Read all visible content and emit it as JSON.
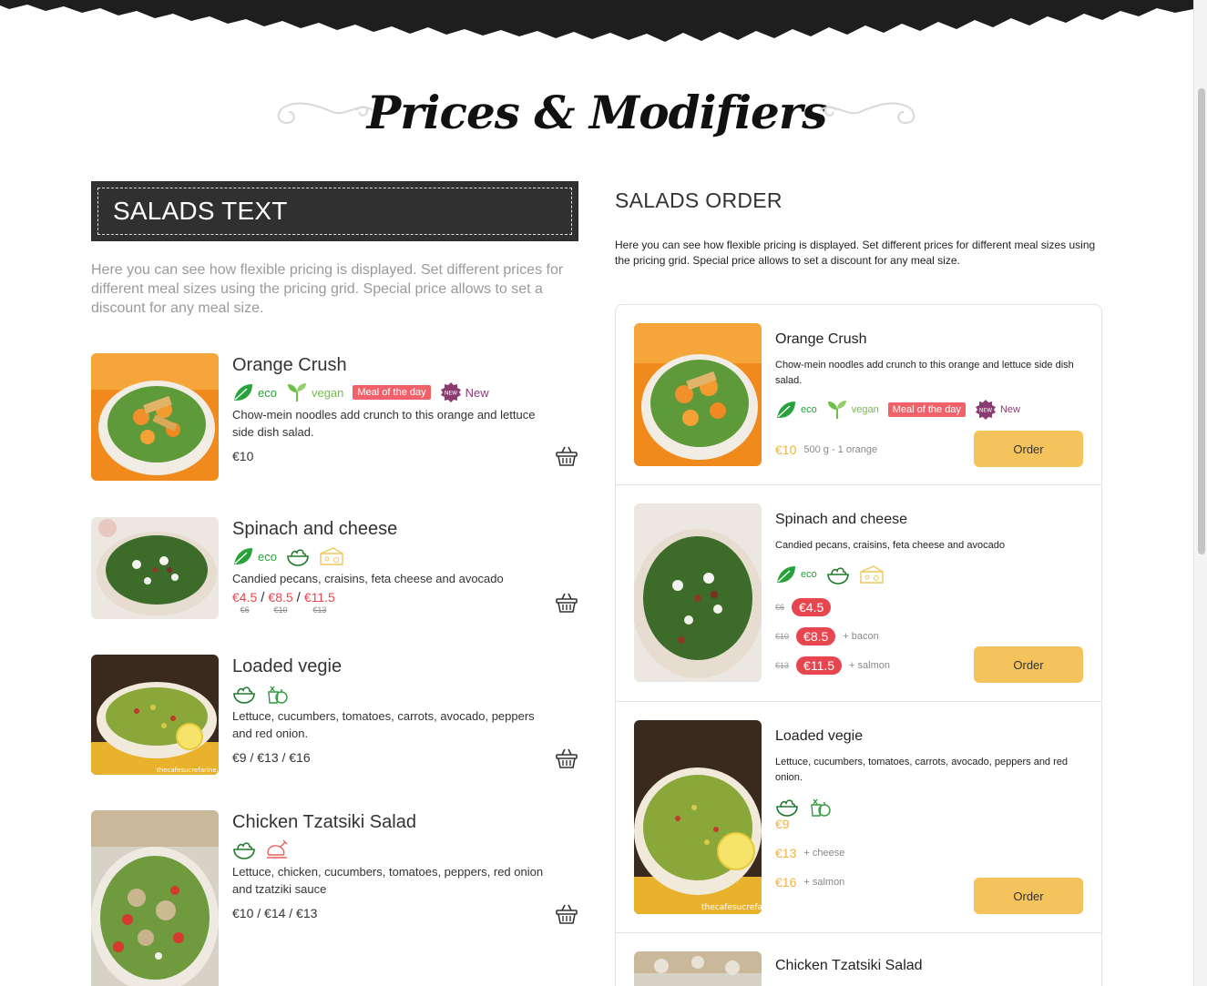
{
  "page": {
    "title": "Prices & Modifiers"
  },
  "left": {
    "section_title": "SALADS TEXT",
    "description": "Here you can see how flexible pricing is displayed. Set different prices for different meal sizes using the pricing grid. Special price allows to set a discount for any meal size.",
    "items": [
      {
        "name": "Orange Crush",
        "tags": {
          "eco": "eco",
          "vegan": "vegan",
          "meal": "Meal of the day",
          "new": "New"
        },
        "description": "Chow-mein noodles add crunch to this orange and lettuce side dish salad.",
        "price": "€10"
      },
      {
        "name": "Spinach and cheese",
        "tags": {
          "eco": "eco"
        },
        "description": "Candied pecans, craisins, feta cheese and avocado",
        "special_prices": [
          {
            "new": "€4.5",
            "old": "€6"
          },
          {
            "new": "€8.5",
            "old": "€10"
          },
          {
            "new": "€11.5",
            "old": "€13"
          }
        ],
        "sep": "/"
      },
      {
        "name": "Loaded vegie",
        "description": "Lettuce, cucumbers, tomatoes, carrots, avocado, peppers and red onion.",
        "price": "€9 / €13 / €16"
      },
      {
        "name": "Chicken Tzatsiki Salad",
        "description": "Lettuce, chicken, cucumbers, tomatoes, peppers, red onion and tzatziki sauce",
        "price": "€10 / €14 / €13"
      }
    ]
  },
  "right": {
    "section_title": "SALADS ORDER",
    "description": "Here you can see how flexible pricing is displayed. Set different prices for different meal sizes using the pricing grid. Special price allows to set a discount for any meal size.",
    "order_label": "Order",
    "items": [
      {
        "name": "Orange Crush",
        "description": "Chow-mein noodles add crunch to this orange and lettuce side dish salad.",
        "tags": {
          "eco": "eco",
          "vegan": "vegan",
          "meal": "Meal of the day",
          "new": "New"
        },
        "price": "€10",
        "note": "500 g - 1 orange"
      },
      {
        "name": "Spinach and cheese",
        "description": "Candied pecans, craisins, feta cheese and avocado",
        "tags": {
          "eco": "eco"
        },
        "prices": [
          {
            "old": "€6",
            "new": "€4.5",
            "note": ""
          },
          {
            "old": "€10",
            "new": "€8.5",
            "note": "+ bacon"
          },
          {
            "old": "€13",
            "new": "€11.5",
            "note": "+ salmon"
          }
        ]
      },
      {
        "name": "Loaded vegie",
        "description": "Lettuce, cucumbers, tomatoes, carrots, avocado, peppers and red onion.",
        "prices": [
          {
            "price": "€9",
            "note": ""
          },
          {
            "price": "€13",
            "note": "+ cheese"
          },
          {
            "price": "€16",
            "note": "+ salmon"
          }
        ]
      },
      {
        "name": "Chicken Tzatsiki Salad"
      }
    ]
  },
  "image_watermark": "thecafesucrefarine.com",
  "colors": {
    "accent_yellow": "#f5c35b",
    "price_yellow": "#f0b43c",
    "special_red": "#e8464f",
    "eco_green": "#27a13a",
    "new_purple": "#8a3c72",
    "dark_box": "#303030"
  },
  "icons": [
    "leaf-icon",
    "sprout-icon",
    "new-badge-icon",
    "bowl-icon",
    "cheese-icon",
    "vegetables-icon",
    "chicken-icon",
    "basket-icon",
    "swirl-ornament"
  ]
}
